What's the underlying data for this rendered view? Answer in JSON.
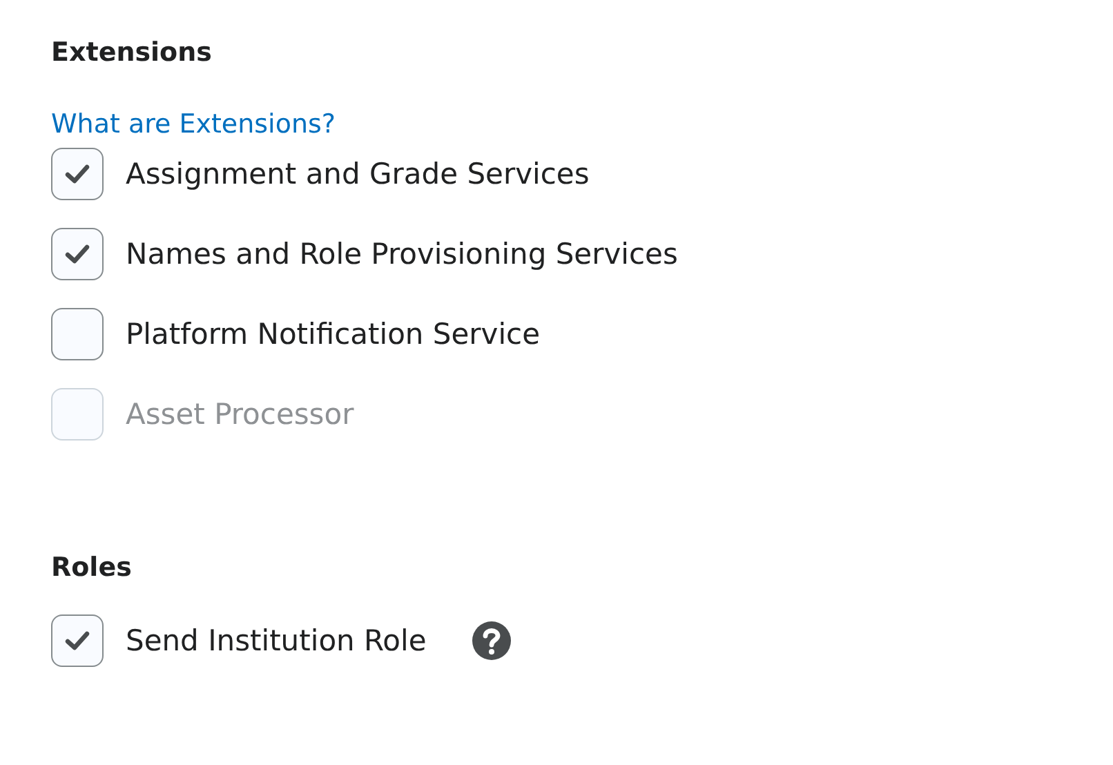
{
  "extensions": {
    "heading": "Extensions",
    "help_link": "What are Extensions?",
    "items": [
      {
        "label": "Assignment and Grade Services",
        "checked": true,
        "disabled": false
      },
      {
        "label": "Names and Role Provisioning Services",
        "checked": true,
        "disabled": false
      },
      {
        "label": "Platform Notification Service",
        "checked": false,
        "disabled": false
      },
      {
        "label": "Asset Processor",
        "checked": false,
        "disabled": true
      }
    ]
  },
  "roles": {
    "heading": "Roles",
    "items": [
      {
        "label": "Send Institution Role",
        "checked": true,
        "disabled": false,
        "help": true
      }
    ]
  }
}
